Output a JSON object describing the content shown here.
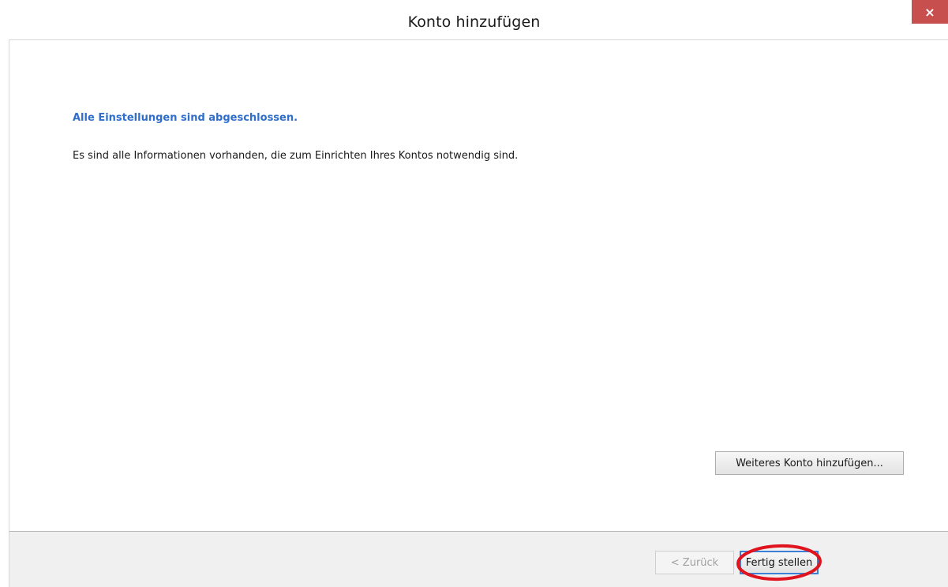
{
  "window": {
    "title": "Konto hinzufügen",
    "close_label": "×"
  },
  "content": {
    "heading": "Alle Einstellungen sind abgeschlossen.",
    "info": "Es sind alle Informationen vorhanden, die zum Einrichten Ihres Kontos notwendig sind.",
    "add_account_button": "Weiteres Konto hinzufügen..."
  },
  "footer": {
    "back_button": "< Zurück",
    "finish_button": "Fertig stellen"
  },
  "colors": {
    "heading": "#2f6ecb",
    "close_button": "#c7504f",
    "annotation": "#e0141e"
  }
}
